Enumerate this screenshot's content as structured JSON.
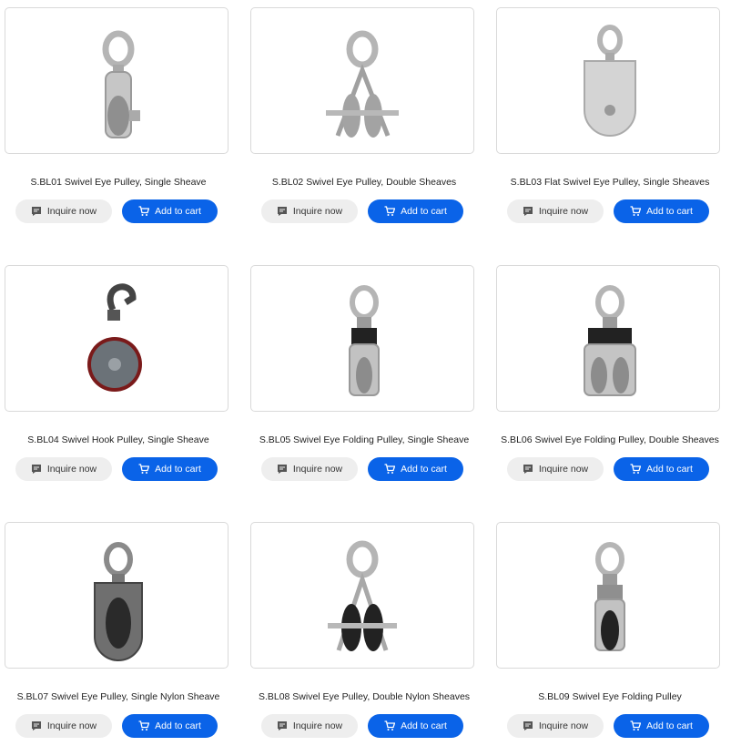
{
  "products": [
    {
      "title": "S.BL01 Swivel Eye Pulley, Single Sheave",
      "inquire_label": "Inquire now",
      "cart_label": "Add to cart"
    },
    {
      "title": "S.BL02 Swivel Eye Pulley, Double Sheaves",
      "inquire_label": "Inquire now",
      "cart_label": "Add to cart"
    },
    {
      "title": "S.BL03 Flat Swivel Eye Pulley, Single Sheaves",
      "inquire_label": "Inquire now",
      "cart_label": "Add to cart"
    },
    {
      "title": "S.BL04 Swivel Hook Pulley, Single Sheave",
      "inquire_label": "Inquire now",
      "cart_label": "Add to cart"
    },
    {
      "title": "S.BL05 Swivel Eye Folding Pulley, Single Sheave",
      "inquire_label": "Inquire now",
      "cart_label": "Add to cart"
    },
    {
      "title": "S.BL06 Swivel Eye Folding Pulley, Double Sheaves",
      "inquire_label": "Inquire now",
      "cart_label": "Add to cart"
    },
    {
      "title": "S.BL07 Swivel Eye Pulley, Single Nylon Sheave",
      "inquire_label": "Inquire now",
      "cart_label": "Add to cart"
    },
    {
      "title": "S.BL08 Swivel Eye Pulley, Double Nylon Sheaves",
      "inquire_label": "Inquire now",
      "cart_label": "Add to cart"
    },
    {
      "title": "S.BL09 Swivel Eye Folding Pulley",
      "inquire_label": "Inquire now",
      "cart_label": "Add to cart"
    }
  ],
  "colors": {
    "cart_button": "#0a63e8",
    "inquire_button": "#eeeeee",
    "card_border": "#d9d9d9"
  },
  "icons": {
    "inquire": "chat-icon",
    "cart": "cart-icon"
  }
}
